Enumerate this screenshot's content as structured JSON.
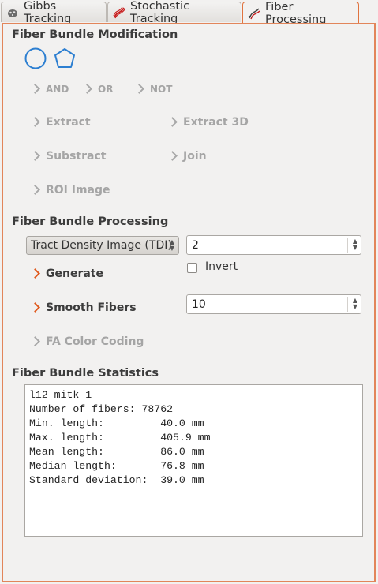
{
  "tabs": [
    {
      "label": "Gibbs Tracking",
      "icon": "gibbs-tracking-icon"
    },
    {
      "label": "Stochastic Tracking",
      "icon": "stochastic-tracking-icon"
    },
    {
      "label": "Fiber Processing",
      "icon": "fiber-processing-icon"
    }
  ],
  "modification": {
    "title": "Fiber Bundle Modification",
    "shape_buttons": [
      "circle-roi-icon",
      "polygon-roi-icon"
    ],
    "logic": {
      "and": "AND",
      "or": "OR",
      "not": "NOT"
    },
    "extract": "Extract",
    "extract3d": "Extract 3D",
    "substract": "Substract",
    "join": "Join",
    "roi_image": "ROI Image"
  },
  "processing": {
    "title": "Fiber Bundle Processing",
    "method_combo": "Tract Density Image (TDI)",
    "upsampling_value": "2",
    "generate": "Generate",
    "invert_label": "Invert",
    "invert_checked": false,
    "smooth": "Smooth Fibers",
    "smooth_value": "10",
    "fa_color": "FA Color Coding"
  },
  "statistics": {
    "title": "Fiber Bundle Statistics",
    "text": "l12_mitk_1\nNumber of fibers: 78762\nMin. length:         40.0 mm\nMax. length:         405.9 mm\nMean length:         86.0 mm\nMedian length:       76.8 mm\nStandard deviation:  39.0 mm"
  },
  "colors": {
    "accent": "#e2855a",
    "active_chevron": "#e05a1e",
    "disabled_text": "#a5a5a5",
    "roi_blue": "#2d7fd1"
  }
}
